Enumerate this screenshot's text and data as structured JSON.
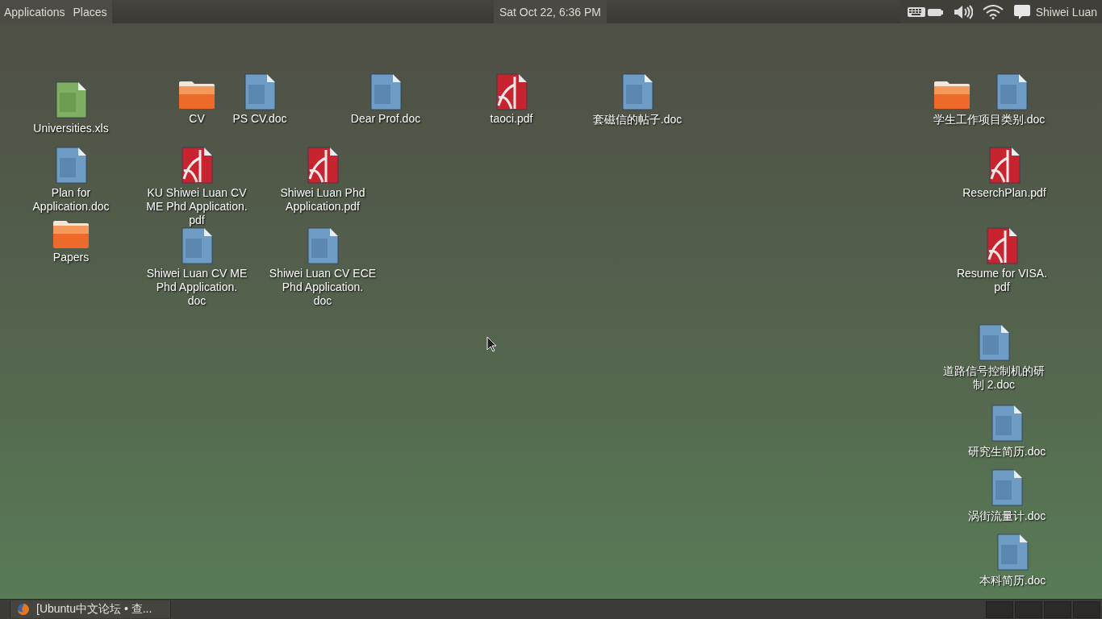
{
  "top_panel": {
    "menus": [
      "Applications",
      "Places"
    ],
    "clock": "Sat Oct 22,  6:36 PM",
    "user": "Shiwei Luan"
  },
  "desktop_icons": [
    {
      "kind": "xls",
      "label": [
        "Universities.xls"
      ]
    },
    {
      "kind": "folder",
      "label": [
        "CV"
      ]
    },
    {
      "kind": "doc",
      "label": [
        "PS CV.doc"
      ]
    },
    {
      "kind": "doc",
      "label": [
        "Dear Prof.doc"
      ]
    },
    {
      "kind": "pdf",
      "label": [
        "taoci.pdf"
      ]
    },
    {
      "kind": "doc",
      "label": [
        "套磁信的帖子.doc"
      ]
    },
    {
      "kind": "folder"
    },
    {
      "kind": "doc",
      "label": [
        "学生工作项目类别.doc"
      ]
    },
    {
      "kind": "doc",
      "label": [
        "Plan for",
        "Application.doc"
      ]
    },
    {
      "kind": "pdf",
      "label": [
        "KU Shiwei Luan CV",
        "ME Phd Application.",
        "pdf"
      ]
    },
    {
      "kind": "pdf",
      "label": [
        "Shiwei Luan Phd",
        "Application.pdf"
      ]
    },
    {
      "kind": "pdf",
      "label": [
        "ReserchPlan.pdf"
      ]
    },
    {
      "kind": "folder",
      "label": [
        "Papers"
      ]
    },
    {
      "kind": "doc",
      "label": [
        "Shiwei Luan CV ME",
        "Phd Application.",
        "doc"
      ]
    },
    {
      "kind": "doc",
      "label": [
        "Shiwei Luan CV ECE",
        "Phd Application.",
        "doc"
      ]
    },
    {
      "kind": "pdf",
      "label": [
        "Resume for VISA.",
        "pdf"
      ]
    },
    {
      "kind": "doc",
      "label": [
        "道路信号控制机的研",
        "制 2.doc"
      ]
    },
    {
      "kind": "doc",
      "label": [
        "研究生简历.doc"
      ]
    },
    {
      "kind": "doc",
      "label": [
        "涡街流量计.doc"
      ]
    },
    {
      "kind": "doc",
      "label": [
        "本科简历.doc"
      ]
    }
  ],
  "taskbar": {
    "windows": [
      {
        "title": "[Ubuntu中文论坛 • 查..."
      }
    ]
  }
}
